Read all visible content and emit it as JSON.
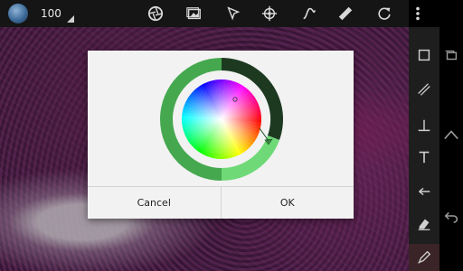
{
  "toolbar": {
    "zoom_value": "100",
    "icons": [
      "aperture-icon",
      "gallery-icon",
      "cursor-icon",
      "crosshair-icon",
      "curve-icon",
      "ruler-icon",
      "rotate-icon",
      "overflow-menu-icon"
    ]
  },
  "right_tools": [
    "rectangle-icon",
    "line-icon",
    "perpendicular-icon",
    "text-icon",
    "arrow-icon",
    "eraser-icon",
    "pen-icon"
  ],
  "nav": [
    "recents-icon",
    "home-icon",
    "back-icon"
  ],
  "dialog": {
    "cancel_label": "Cancel",
    "ok_label": "OK",
    "selected_color": "#4caf50",
    "brightness_dark": "#1b5e20"
  },
  "colors": {
    "toolbar_bg": "#151515",
    "accent_green": "#3fa64a"
  }
}
